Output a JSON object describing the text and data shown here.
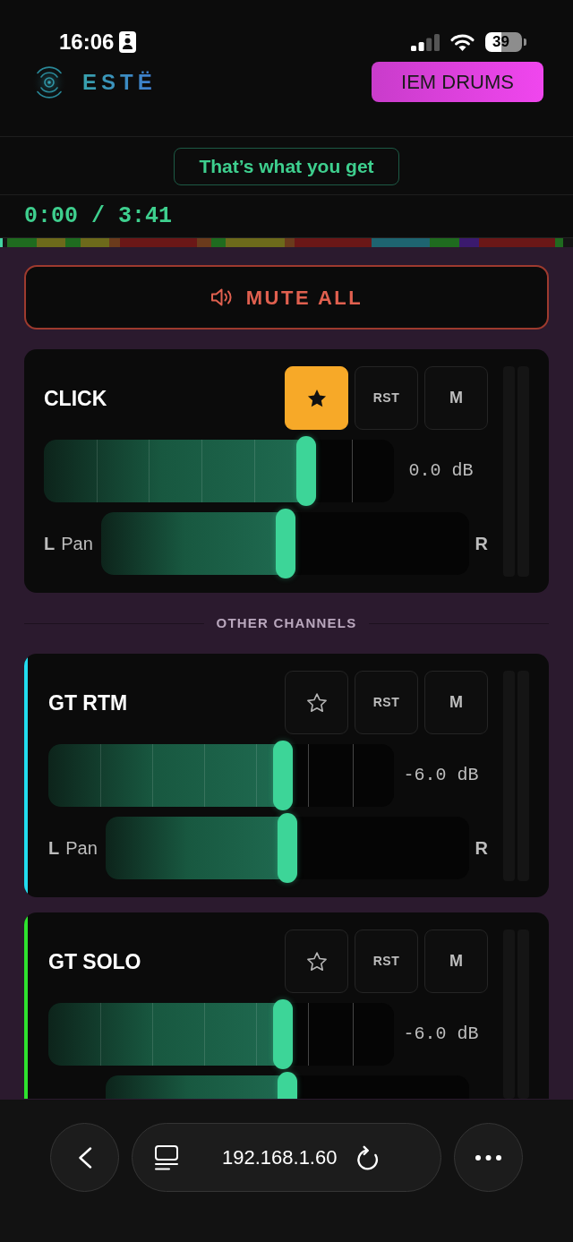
{
  "status_bar": {
    "time": "16:06",
    "battery": "39"
  },
  "header": {
    "logo": "ESTË",
    "mix_button": "IEM DRUMS"
  },
  "song": {
    "title": "That’s what you get",
    "time": "0:00 / 3:41"
  },
  "mute_all": {
    "label": "MUTE ALL"
  },
  "pinned_channels": [
    {
      "name": "CLICK",
      "favorite": true,
      "reset_label": "RST",
      "mute_label": "M",
      "muted": false,
      "cut_off": false,
      "fader": {
        "level": 0.75,
        "reading": "0.0 dB"
      },
      "pan": {
        "level": 0.5,
        "left_label": "L",
        "title": "Pan",
        "right_label": "R"
      }
    }
  ],
  "other_channels": {
    "title": "OTHER CHANNELS",
    "channels": [
      {
        "name": "GT RTM",
        "color": "#22dcef",
        "favorite": false,
        "reset_label": "RST",
        "mute_label": "M",
        "muted": false,
        "cut_off": false,
        "fader": {
          "level": 0.68,
          "reading": "-6.0 dB"
        },
        "pan": {
          "level": 0.5,
          "left_label": "L",
          "title": "Pan",
          "right_label": "R"
        }
      },
      {
        "name": "GT SOLO",
        "color": "#2ee22e",
        "favorite": false,
        "reset_label": "RST",
        "mute_label": "M",
        "muted": false,
        "cut_off": true,
        "fader": {
          "level": 0.68,
          "reading": "-6.0 dB"
        },
        "pan": {
          "level": 0.5
        }
      }
    ]
  },
  "browser_bar": {
    "url": "192.168.1.60"
  }
}
